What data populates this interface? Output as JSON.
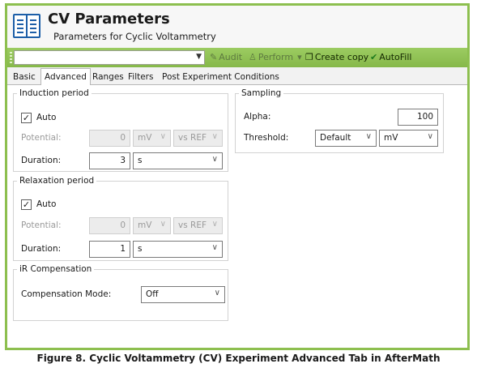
{
  "header": {
    "title": "CV Parameters",
    "subtitle": "Parameters for Cyclic Voltammetry",
    "icon": "document-icon"
  },
  "toolbar": {
    "combo_value": "",
    "audit": "Audit",
    "perform": "Perform",
    "create_copy": "Create copy",
    "autofill": "AutoFill",
    "accent": "#8dbf4f"
  },
  "tabs": [
    "Basic",
    "Advanced",
    "Ranges",
    "Filters",
    "Post Experiment Conditions"
  ],
  "active_tab": "Advanced",
  "induction": {
    "legend": "Induction period",
    "auto_label": "Auto",
    "auto_checked": true,
    "potential_label": "Potential:",
    "potential_value": "0",
    "potential_unit": "mV",
    "reference": "vs REF",
    "duration_label": "Duration:",
    "duration_value": "3",
    "duration_unit": "s"
  },
  "relaxation": {
    "legend": "Relaxation period",
    "auto_label": "Auto",
    "auto_checked": true,
    "potential_label": "Potential:",
    "potential_value": "0",
    "potential_unit": "mV",
    "reference": "vs REF",
    "duration_label": "Duration:",
    "duration_value": "1",
    "duration_unit": "s"
  },
  "ir": {
    "legend": "iR Compensation",
    "mode_label": "Compensation Mode:",
    "mode_value": "Off"
  },
  "sampling": {
    "legend": "Sampling",
    "alpha_label": "Alpha:",
    "alpha_value": "100",
    "threshold_label": "Threshold:",
    "threshold_value": "Default",
    "threshold_unit": "mV"
  },
  "caption": "Figure 8. Cyclic Voltammetry (CV) Experiment Advanced Tab in AfterMath"
}
